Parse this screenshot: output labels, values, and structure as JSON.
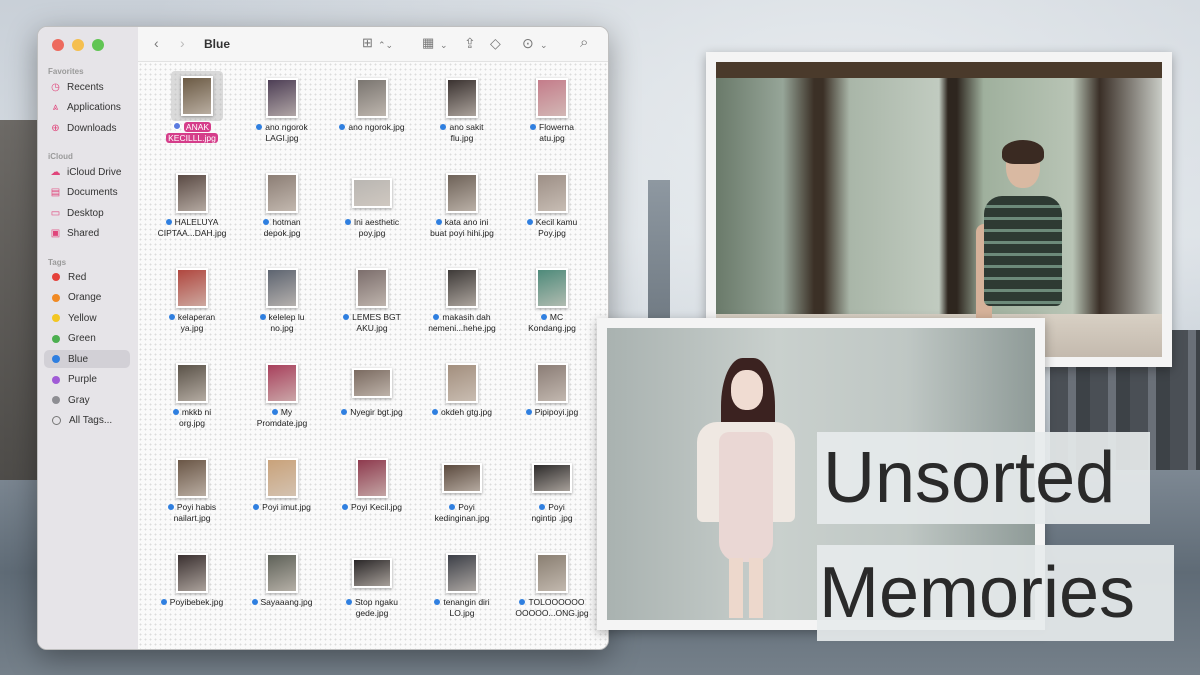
{
  "window": {
    "folder_title": "Blue",
    "traffic_lights": [
      "close",
      "minimize",
      "zoom"
    ]
  },
  "sidebar": {
    "favorites_header": "Favorites",
    "favorites": [
      {
        "label": "Recents",
        "icon": "clock-icon"
      },
      {
        "label": "Applications",
        "icon": "applications-icon"
      },
      {
        "label": "Downloads",
        "icon": "download-icon"
      }
    ],
    "icloud_header": "iCloud",
    "icloud": [
      {
        "label": "iCloud Drive",
        "icon": "cloud-icon"
      },
      {
        "label": "Documents",
        "icon": "document-icon"
      },
      {
        "label": "Desktop",
        "icon": "desktop-icon"
      },
      {
        "label": "Shared",
        "icon": "shared-folder-icon"
      }
    ],
    "tags_header": "Tags",
    "tags": [
      {
        "label": "Red",
        "color": "#e5413b"
      },
      {
        "label": "Orange",
        "color": "#f08a24"
      },
      {
        "label": "Yellow",
        "color": "#f3c623"
      },
      {
        "label": "Green",
        "color": "#4caf50"
      },
      {
        "label": "Blue",
        "color": "#2f7fe0"
      },
      {
        "label": "Purple",
        "color": "#a05bd6"
      },
      {
        "label": "Gray",
        "color": "#8e8e93"
      },
      {
        "label": "All Tags...",
        "color": ""
      }
    ],
    "selected": "Blue"
  },
  "toolbar": {
    "back": "‹",
    "forward": "›",
    "view_icons": "⊞",
    "group": "▦",
    "share": "⇪",
    "tag": "◇",
    "more": "⊙",
    "search": "⌕"
  },
  "files": [
    {
      "line1": "ANAK",
      "line2": "KECILLL.jpg",
      "selected": true,
      "thumb": "#6b5a44"
    },
    {
      "line1": "ano ngorok",
      "line2": "LAGI.jpg",
      "thumb": "#4d3e55"
    },
    {
      "line1": "ano ngorok.jpg",
      "line2": "",
      "thumb": "#7a7570"
    },
    {
      "line1": "ano sakit",
      "line2": "flu.jpg",
      "thumb": "#3a3230"
    },
    {
      "line1": "Flowerna",
      "line2": "atu.jpg",
      "thumb": "#c47c8a"
    },
    {
      "line1": "HALELUYA",
      "line2": "CIPTAA...DAH.jpg",
      "thumb": "#5a4a44"
    },
    {
      "line1": "hotman",
      "line2": "depok.jpg",
      "thumb": "#8c7e75"
    },
    {
      "line1": "Ini aesthetic",
      "line2": "poy.jpg",
      "thumb": "#b9b6b2"
    },
    {
      "line1": "kata ano ini",
      "line2": "buat poyi hihi.jpg",
      "thumb": "#6e6258"
    },
    {
      "line1": "Kecil kamu",
      "line2": "Poy.jpg",
      "thumb": "#9d8f86"
    },
    {
      "line1": "kelaperan",
      "line2": "ya.jpg",
      "thumb": "#b0473f"
    },
    {
      "line1": "kelelep lu",
      "line2": "no.jpg",
      "thumb": "#5d6470"
    },
    {
      "line1": "LEMES BGT",
      "line2": "AKU.jpg",
      "thumb": "#7c6e6c"
    },
    {
      "line1": "makasih dah",
      "line2": "nemeni...hehe.jpg",
      "thumb": "#3e3a38"
    },
    {
      "line1": "MC",
      "line2": "Kondang.jpg",
      "thumb": "#4e8a7a"
    },
    {
      "line1": "mkkb ni",
      "line2": "org.jpg",
      "thumb": "#5a5248"
    },
    {
      "line1": "My",
      "line2": "Promdate.jpg",
      "thumb": "#a8405c"
    },
    {
      "line1": "Nyegir bgt.jpg",
      "line2": "",
      "thumb": "#7a6a60"
    },
    {
      "line1": "okdeh gtg.jpg",
      "line2": "",
      "thumb": "#a38f7e"
    },
    {
      "line1": "Pipipoyi.jpg",
      "line2": "",
      "thumb": "#8b7d76"
    },
    {
      "line1": "Poyi habis",
      "line2": "nailart.jpg",
      "thumb": "#6a5646"
    },
    {
      "line1": "Poyi imut.jpg",
      "line2": "",
      "thumb": "#c9a27a"
    },
    {
      "line1": "Poyi Kecil.jpg",
      "line2": "",
      "thumb": "#8e3a4e"
    },
    {
      "line1": "Poyi",
      "line2": "kedinginan.jpg",
      "thumb": "#5b4a3e"
    },
    {
      "line1": "Poyi",
      "line2": "ngintip .jpg",
      "thumb": "#2c2a2a"
    },
    {
      "line1": "Poyibebek.jpg",
      "line2": "",
      "thumb": "#3a3030"
    },
    {
      "line1": "Sayaaang.jpg",
      "line2": "",
      "thumb": "#5e6158"
    },
    {
      "line1": "Stop ngaku",
      "line2": "gede.jpg",
      "thumb": "#2a2728"
    },
    {
      "line1": "tenangin diri",
      "line2": "LO.jpg",
      "thumb": "#3c3f47"
    },
    {
      "line1": "TOLOOOOOO",
      "line2": "OOOOO...ONG.jpg",
      "thumb": "#8a7f72"
    }
  ],
  "overlay": {
    "title_word1": "Unsorted",
    "title_word2": "Memories"
  }
}
